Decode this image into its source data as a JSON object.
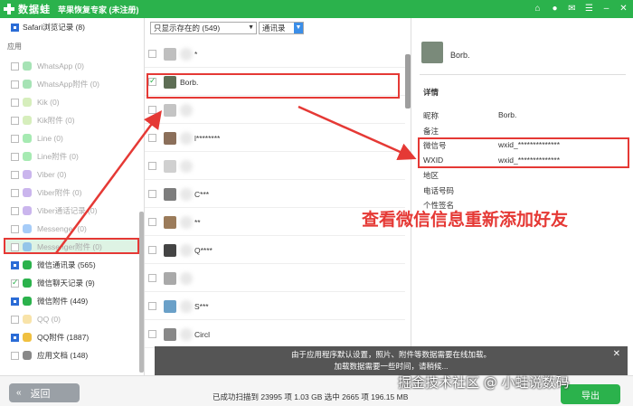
{
  "title": {
    "app_name": "数据蛙",
    "subtitle": "苹果恢复专家 (未注册)"
  },
  "colors": {
    "brand": "#2bb24c",
    "annotation": "#e53935",
    "checked": "#2b6cd6"
  },
  "sidebar": {
    "top_item": "Safari浏览记录 (8)",
    "section_label": "应用",
    "items": [
      {
        "label": "WhatsApp (0)",
        "icon": "whatsapp-icon",
        "color": "#39c25a",
        "muted": true
      },
      {
        "label": "WhatsApp附件 (0)",
        "icon": "whatsapp-icon",
        "color": "#39c25a",
        "muted": true
      },
      {
        "label": "Kik (0)",
        "icon": "kik-icon",
        "color": "#a5d96a",
        "muted": true
      },
      {
        "label": "Kik附件 (0)",
        "icon": "kik-icon",
        "color": "#a5d96a",
        "muted": true
      },
      {
        "label": "Line (0)",
        "icon": "line-icon",
        "color": "#3ad055",
        "muted": true
      },
      {
        "label": "Line附件 (0)",
        "icon": "line-icon",
        "color": "#3ad055",
        "muted": true
      },
      {
        "label": "Viber (0)",
        "icon": "viber-icon",
        "color": "#8a5bd6",
        "muted": true
      },
      {
        "label": "Viber附件 (0)",
        "icon": "viber-icon",
        "color": "#8a5bd6",
        "muted": true
      },
      {
        "label": "Viber通话记录 (0)",
        "icon": "viber-icon",
        "color": "#8a5bd6",
        "muted": true
      },
      {
        "label": "Messenger (0)",
        "icon": "messenger-icon",
        "color": "#3a8ef0",
        "muted": true
      },
      {
        "label": "Messenger附件 (0)",
        "icon": "messenger-icon",
        "color": "#3a8ef0",
        "muted": true
      },
      {
        "label": "微信通讯录 (565)",
        "icon": "wechat-icon",
        "color": "#2bb24c",
        "muted": false
      },
      {
        "label": "微信聊天记录 (9)",
        "icon": "wechat-icon",
        "color": "#2bb24c",
        "muted": false
      },
      {
        "label": "微信附件 (449)",
        "icon": "wechat-icon",
        "color": "#2bb24c",
        "muted": false
      },
      {
        "label": "QQ (0)",
        "icon": "qq-icon",
        "color": "#f0c040",
        "muted": true
      },
      {
        "label": "QQ附件 (1887)",
        "icon": "qq-icon",
        "color": "#f0c040",
        "muted": false
      },
      {
        "label": "应用文档 (148)",
        "icon": "document-icon",
        "color": "#888888",
        "muted": false
      }
    ]
  },
  "middle": {
    "filter_value": "只显示存在的 (549)",
    "view_value": "通讯录",
    "rows": [
      {
        "name": "*"
      },
      {
        "name": "Borb."
      },
      {
        "name": ""
      },
      {
        "name": "l********"
      },
      {
        "name": ""
      },
      {
        "name": "C***"
      },
      {
        "name": "**"
      },
      {
        "name": "Q****"
      },
      {
        "name": ""
      },
      {
        "name": "S***"
      },
      {
        "name": "Circl"
      }
    ]
  },
  "detail": {
    "name": "Borb.",
    "section_title": "详情",
    "fields": [
      {
        "label": "昵称",
        "value": "Borb."
      },
      {
        "label": "备注",
        "value": ""
      },
      {
        "label": "微信号",
        "value": "wxid_**************"
      },
      {
        "label": "WXID",
        "value": "wxid_**************"
      },
      {
        "label": "地区",
        "value": ""
      },
      {
        "label": "电话号码",
        "value": ""
      },
      {
        "label": "个性签名",
        "value": ""
      }
    ]
  },
  "annotation": "查看微信信息重新添加好友",
  "notice": {
    "line1": "由于应用程序默认设置，照片、附件等数据需要在线加载。",
    "line2": "加载数据需要一些时间，请稍候..."
  },
  "bottom": {
    "back_label": "返回",
    "status": "已成功扫描到 23995 项 1.03 GB  选中 2665 项 196.15 MB",
    "export_label": "导出",
    "watermark": "掘金技术社区 @ 小蛙说数码"
  }
}
